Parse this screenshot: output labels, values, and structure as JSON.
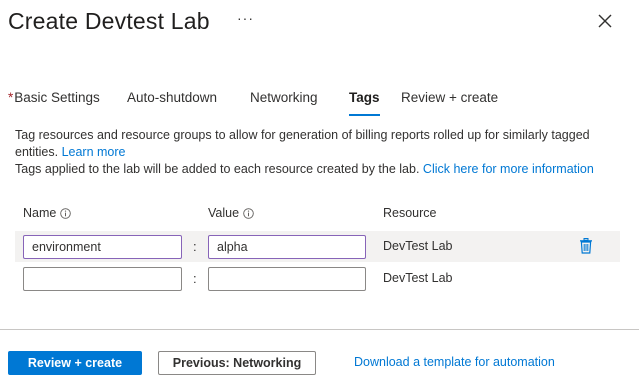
{
  "header": {
    "title": "Create Devtest Lab",
    "more_glyph": "···",
    "close_icon": "close-icon"
  },
  "tabs": [
    {
      "label": "Basic Settings",
      "required": true,
      "active": false
    },
    {
      "label": "Auto-shutdown",
      "required": false,
      "active": false
    },
    {
      "label": "Networking",
      "required": false,
      "active": false
    },
    {
      "label": "Tags",
      "required": false,
      "active": true
    },
    {
      "label": "Review + create",
      "required": false,
      "active": false
    }
  ],
  "required_marker": "*",
  "description": {
    "line1": "Tag resources and resource groups to allow for generation of billing reports rolled up for similarly tagged",
    "line2_prefix": "entities.",
    "learn_more": "Learn more",
    "line3_prefix": "Tags applied to the lab will be added to each resource created by the lab.",
    "more_info": "Click here for more information"
  },
  "table": {
    "headers": {
      "name": "Name",
      "value": "Value",
      "resource": "Resource"
    },
    "separator": ":",
    "rows": [
      {
        "name": "environment",
        "value": "alpha",
        "resource": "DevTest Lab",
        "deletable": true
      },
      {
        "name": "",
        "value": "",
        "resource": "DevTest Lab",
        "deletable": false
      }
    ]
  },
  "footer": {
    "primary_label": "Review + create",
    "secondary_label": "Previous: Networking",
    "download_link": "Download a template for automation"
  },
  "colors": {
    "accent": "#0078d4",
    "focus_border": "#8764b8",
    "required": "#a4262c",
    "row_highlight": "#f3f2f1"
  }
}
